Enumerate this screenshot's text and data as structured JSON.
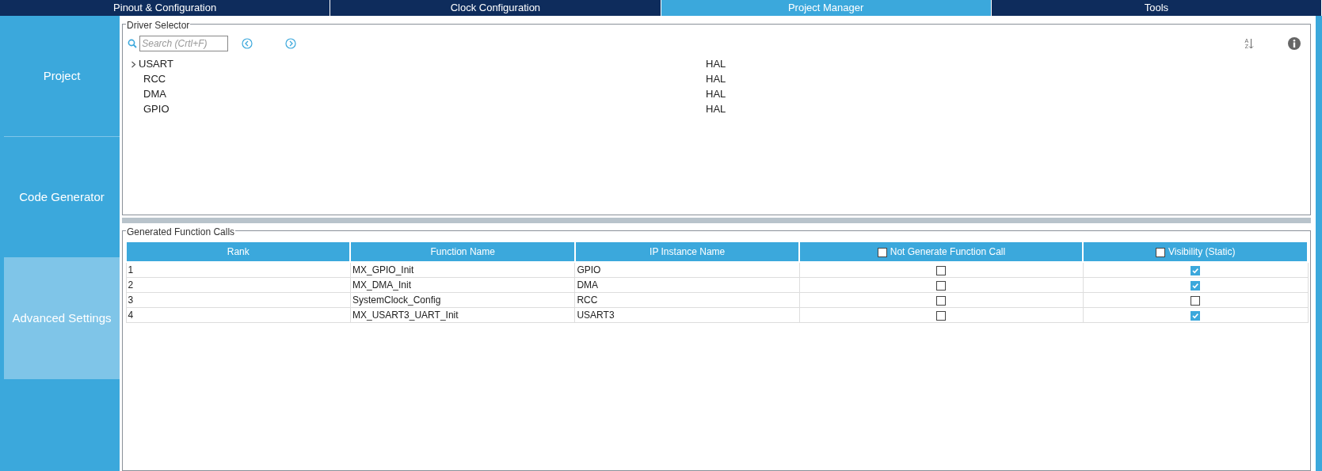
{
  "tabs": [
    {
      "label": "Pinout & Configuration",
      "selected": false
    },
    {
      "label": "Clock Configuration",
      "selected": false
    },
    {
      "label": "Project Manager",
      "selected": true
    },
    {
      "label": "Tools",
      "selected": false
    }
  ],
  "sidebar": {
    "items": [
      {
        "label": "Project",
        "selected": false
      },
      {
        "label": "Code Generator",
        "selected": false
      },
      {
        "label": "Advanced Settings",
        "selected": true
      }
    ]
  },
  "driver_selector": {
    "title": "Driver Selector",
    "search": {
      "placeholder": "Search (Crtl+F)"
    },
    "sort_letters": [
      "A",
      "Z"
    ],
    "items": [
      {
        "kind": "group",
        "label": "USART",
        "value": "HAL",
        "expanded": false
      },
      {
        "kind": "leaf",
        "label": "RCC",
        "value": "HAL"
      },
      {
        "kind": "leaf",
        "label": "DMA",
        "value": "HAL"
      },
      {
        "kind": "leaf",
        "label": "GPIO",
        "value": "HAL"
      }
    ]
  },
  "function_calls": {
    "title": "Generated Function Calls",
    "columns": [
      {
        "label": "Rank"
      },
      {
        "label": "Function Name"
      },
      {
        "label": "IP Instance Name"
      },
      {
        "label": "Not Generate Function Call",
        "checked": false
      },
      {
        "label": "Visibility (Static)",
        "checked": false
      }
    ],
    "rows": [
      {
        "rank": "1",
        "function": "MX_GPIO_Init",
        "instance": "GPIO",
        "not_generate": false,
        "visibility": true
      },
      {
        "rank": "2",
        "function": "MX_DMA_Init",
        "instance": "DMA",
        "not_generate": false,
        "visibility": true
      },
      {
        "rank": "3",
        "function": "SystemClock_Config",
        "instance": "RCC",
        "not_generate": false,
        "visibility": false
      },
      {
        "rank": "4",
        "function": "MX_USART3_UART_Init",
        "instance": "USART3",
        "not_generate": false,
        "visibility": true
      }
    ]
  }
}
